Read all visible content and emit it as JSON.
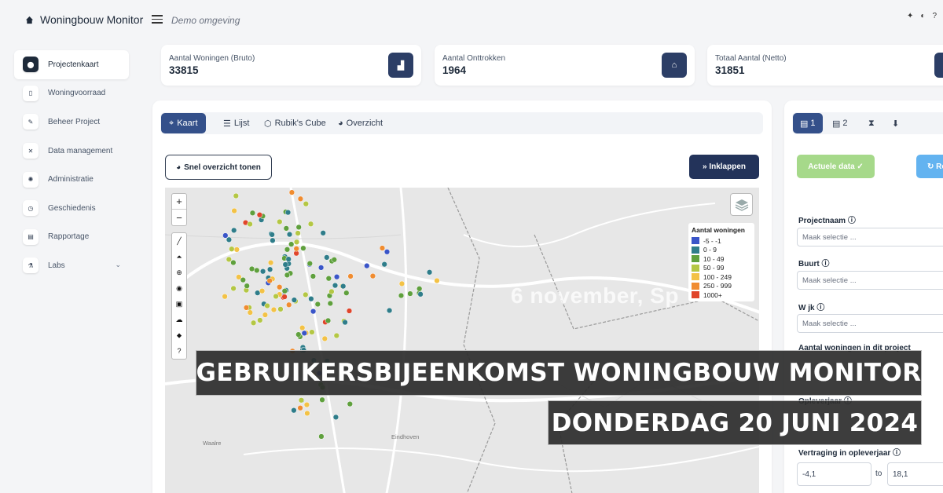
{
  "app": {
    "title": "Woningbouw Monitor",
    "environment": "Demo omgeving"
  },
  "top_icons": [
    "sparkle-icon",
    "contrast-icon",
    "help-icon"
  ],
  "sidebar": {
    "items": [
      {
        "label": "Projectenkaart",
        "icon": "map-pin-icon",
        "active": true
      },
      {
        "label": "Woningvoorraad",
        "icon": "document-icon"
      },
      {
        "label": "Beheer Project",
        "icon": "edit-icon"
      },
      {
        "label": "Data management",
        "icon": "tools-icon"
      },
      {
        "label": "Administratie",
        "icon": "gear-icon"
      },
      {
        "label": "Geschiedenis",
        "icon": "clock-icon"
      },
      {
        "label": "Rapportage",
        "icon": "report-icon"
      },
      {
        "label": "Labs",
        "icon": "flask-icon",
        "has_chevron": true
      }
    ]
  },
  "stats": [
    {
      "label": "Aantal Woningen (Bruto)",
      "value": "33815"
    },
    {
      "label": "Aantal Onttrokken",
      "value": "1964"
    },
    {
      "label": "Totaal Aantal (Netto)",
      "value": "31851"
    }
  ],
  "main": {
    "tabs": [
      {
        "label": "Kaart",
        "active": true
      },
      {
        "label": "Lijst"
      },
      {
        "label": "Rubik's Cube"
      },
      {
        "label": "Overzicht"
      }
    ],
    "overview_button": "Snel overzicht tonen",
    "collapse_button": "Inklappen"
  },
  "map": {
    "legend_title": "Aantal woningen",
    "legend": [
      {
        "label": "-5 - -1",
        "color": "#3a55c8"
      },
      {
        "label": "0 - 9",
        "color": "#2f7d8a"
      },
      {
        "label": "10 - 49",
        "color": "#5fa03d"
      },
      {
        "label": "50 - 99",
        "color": "#b4c744"
      },
      {
        "label": "100 - 249",
        "color": "#f3c246"
      },
      {
        "label": "250 - 999",
        "color": "#f08c30"
      },
      {
        "label": "1000+",
        "color": "#e0452b"
      }
    ],
    "place_labels": [
      "Eindhoven",
      "Waalre"
    ],
    "watermark": "6 november, Sp"
  },
  "right": {
    "tabs": [
      {
        "label": "1",
        "active": true
      },
      {
        "label": "2"
      },
      {
        "label": ""
      },
      {
        "label": ""
      }
    ],
    "current_data_button": "Actuele data ✓",
    "reset_button": "Re",
    "filters": {
      "projectnaam": "Projectnaam",
      "buurt": "Buurt",
      "wijk": "W jk",
      "aantal": "Aantal woningen in dit project",
      "opleverjaar": "Opleverjaar",
      "vertraging": "Vertraging in opleverjaar",
      "placeholder": "Maak selectie ...",
      "range_from": "-4,1",
      "range_to": "18,1",
      "to_label": "to"
    }
  },
  "banners": {
    "line1": "GEBRUIKERSBIJEENKOMST WONINGBOUW MONITOR",
    "line2": "DONDERDAG 20 JUNI 2024"
  }
}
